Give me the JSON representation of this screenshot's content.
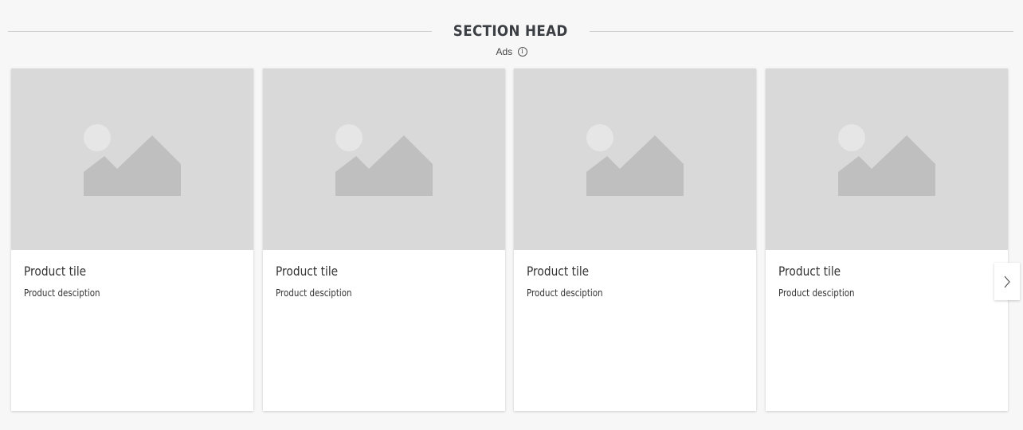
{
  "section": {
    "title": "SECTION HEAD",
    "ads_label": "Ads",
    "info_icon": "info-icon"
  },
  "cards": [
    {
      "title": "Product tile",
      "description": "Product desciption",
      "image_icon": "image-placeholder-icon"
    },
    {
      "title": "Product tile",
      "description": "Product desciption",
      "image_icon": "image-placeholder-icon"
    },
    {
      "title": "Product tile",
      "description": "Product desciption",
      "image_icon": "image-placeholder-icon"
    },
    {
      "title": "Product tile",
      "description": "Product desciption",
      "image_icon": "image-placeholder-icon"
    }
  ],
  "carousel": {
    "next_icon": "chevron-right-icon"
  },
  "colors": {
    "page_background": "#f7f7f7",
    "image_placeholder": "#d9d9d9",
    "placeholder_shape": "#bfbfbf",
    "placeholder_sun": "#e6e6e6",
    "card_background": "#ffffff",
    "text": "#333333"
  }
}
